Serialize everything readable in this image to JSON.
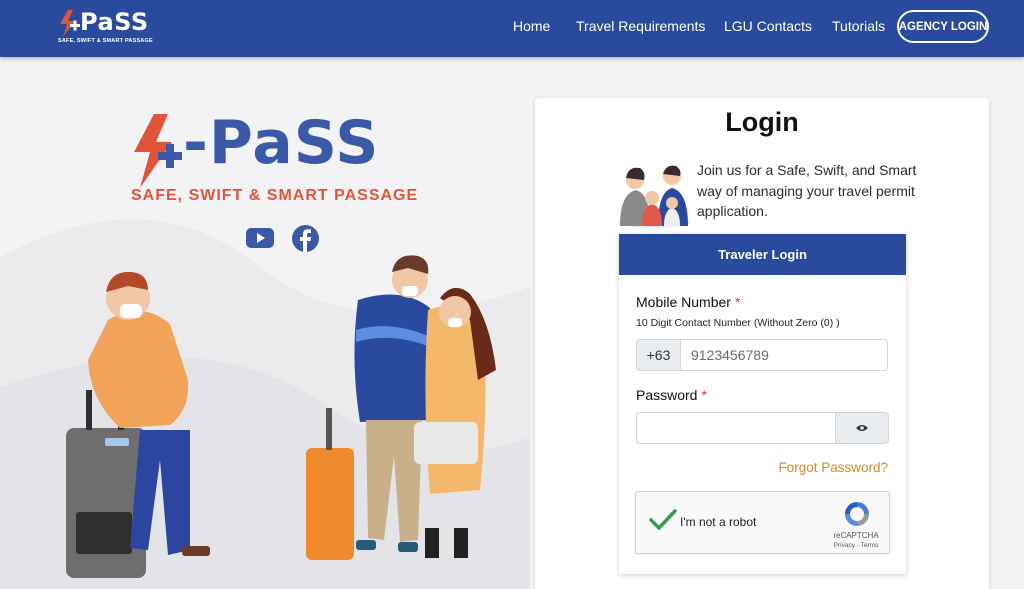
{
  "nav": {
    "logo_word": "PaSS",
    "logo_tagline": "SAFE, SWIFT & SMART PASSAGE",
    "links": [
      "Home",
      "Travel Requirements",
      "LGU Contacts",
      "Tutorials"
    ],
    "agency_login": "AGENCY LOGIN"
  },
  "hero": {
    "logo_word": "-PaSS",
    "tagline": "SAFE, SWIFT & SMART PASSAGE",
    "social": [
      "youtube-icon",
      "facebook-icon"
    ]
  },
  "login": {
    "title": "Login",
    "intro": "Join us for a Safe, Swift, and Smart way of managing your travel permit application.",
    "panel_title": "Traveler Login",
    "mobile_label": "Mobile Number",
    "required_mark": "*",
    "mobile_hint": "10 Digit Contact Number (Without Zero (0) )",
    "country_code": "+63",
    "mobile_placeholder": "9123456789",
    "password_label": "Password",
    "password_value": "",
    "forgot_link": "Forgot Password?",
    "captcha_text": "I'm not a robot",
    "captcha_brand": "reCAPTCHA",
    "captcha_links": "Privacy - Terms",
    "captcha_checked": true
  },
  "colors": {
    "primary": "#2a4a9e",
    "accent_orange": "#e0553a",
    "link_orange": "#d08a2a",
    "check_green": "#2e9e4f"
  }
}
